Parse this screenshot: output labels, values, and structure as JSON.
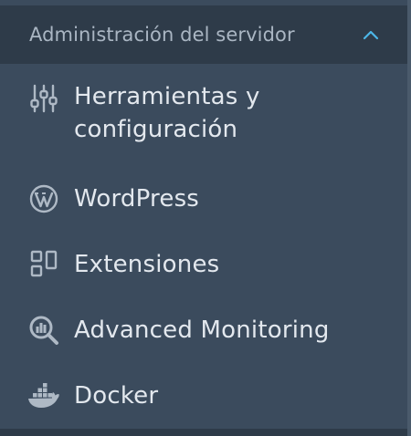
{
  "section": {
    "title": "Administración del servidor",
    "expanded": true,
    "chevron_icon": "chevron-up-icon",
    "accent_color": "#4cb6e8"
  },
  "menu": {
    "items": [
      {
        "label": "Herramientas y\nconfiguración",
        "icon": "sliders-icon"
      },
      {
        "label": "WordPress",
        "icon": "wordpress-icon"
      },
      {
        "label": "Extensiones",
        "icon": "extensions-icon"
      },
      {
        "label": "Advanced Monitoring",
        "icon": "monitoring-icon"
      },
      {
        "label": "Docker",
        "icon": "docker-icon"
      }
    ]
  },
  "colors": {
    "background": "#3b4b5d",
    "header_background": "#2e3b49",
    "text": "#e3e8ee",
    "header_text": "#aab6c3",
    "icon": "#aeb9c5"
  }
}
